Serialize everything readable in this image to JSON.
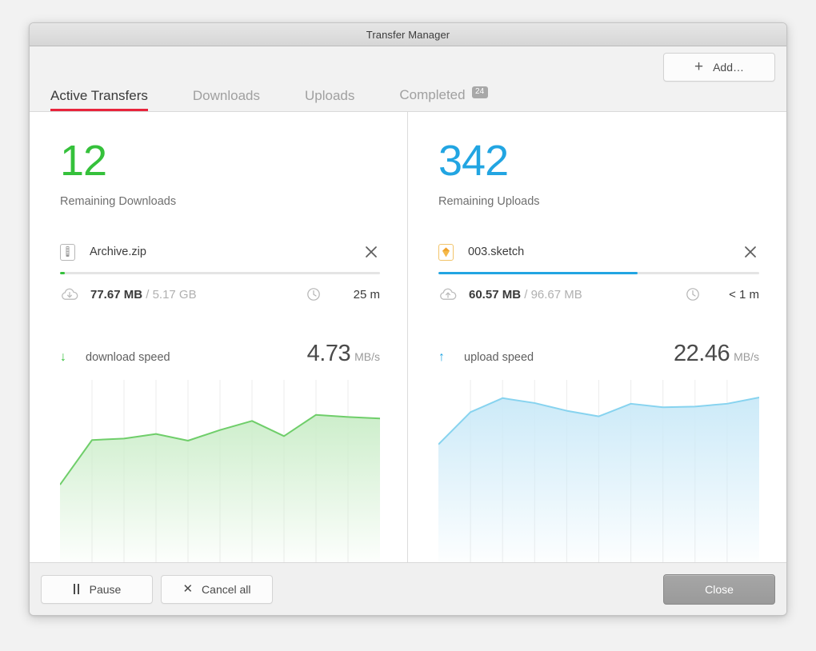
{
  "window": {
    "title": "Transfer Manager"
  },
  "toolbar": {
    "add_label": "Add…",
    "add_icon": "plus-icon"
  },
  "tabs": [
    {
      "label": "Active Transfers",
      "active": true,
      "badge": ""
    },
    {
      "label": "Downloads",
      "active": false,
      "badge": ""
    },
    {
      "label": "Uploads",
      "active": false,
      "badge": ""
    },
    {
      "label": "Completed",
      "active": false,
      "badge": "24"
    }
  ],
  "colors": {
    "accent_red": "#e8243c",
    "green": "#35c13b",
    "blue": "#22a5e2",
    "chart_green_line": "#6fce6a",
    "chart_blue_line": "#87d3ef",
    "badge_grey": "#a8a8a8",
    "close_button_grey": "#9e9e9e",
    "sketch_icon_orange": "#f5a623"
  },
  "downloads": {
    "count": "12",
    "count_label": "Remaining Downloads",
    "file": {
      "name": "Archive.zip",
      "icon": "zip-file-icon",
      "close_icon": "close-icon",
      "progress_percent": 1.5
    },
    "transferred": "77.67 MB",
    "separator": "/",
    "total": "5.17 GB",
    "transfer_icon": "cloud-download-icon",
    "eta_icon": "clock-icon",
    "eta": "25 m",
    "speed_icon": "arrow-down-icon",
    "speed_label": "download speed",
    "speed_value": "4.73",
    "speed_unit": "MB/s"
  },
  "uploads": {
    "count": "342",
    "count_label": "Remaining Uploads",
    "file": {
      "name": "003.sketch",
      "icon": "sketch-file-icon",
      "close_icon": "close-icon",
      "progress_percent": 62
    },
    "transferred": "60.57 MB",
    "separator": "/",
    "total": "96.67 MB",
    "transfer_icon": "cloud-upload-icon",
    "eta_icon": "clock-icon",
    "eta": "< 1 m",
    "speed_icon": "arrow-up-icon",
    "speed_label": "upload speed",
    "speed_value": "22.46",
    "speed_unit": "MB/s"
  },
  "footer": {
    "pause_label": "Pause",
    "pause_icon": "pause-icon",
    "cancel_label": "Cancel all",
    "cancel_icon": "close-icon",
    "close_label": "Close"
  },
  "chart_data": [
    {
      "type": "area",
      "title": "download speed",
      "ylabel": "MB/s",
      "xlabel": "",
      "grid": true,
      "gridlines": 10,
      "legend": "none",
      "ylim": [
        0,
        6
      ],
      "x": [
        0,
        1,
        2,
        3,
        4,
        5,
        6,
        7,
        8,
        9,
        10
      ],
      "values": [
        2.55,
        4.02,
        4.07,
        4.22,
        4.0,
        4.35,
        4.65,
        4.15,
        4.85,
        4.78,
        4.73
      ],
      "line_color": "#6fce6a",
      "fill_color": "#cdeecb"
    },
    {
      "type": "area",
      "title": "upload speed",
      "ylabel": "MB/s",
      "xlabel": "",
      "grid": true,
      "gridlines": 10,
      "legend": "none",
      "ylim": [
        0,
        26
      ],
      "x": [
        0,
        1,
        2,
        3,
        4,
        5,
        6,
        7,
        8,
        9,
        10
      ],
      "values": [
        16.8,
        21.4,
        23.4,
        22.7,
        21.6,
        20.8,
        22.6,
        22.1,
        22.2,
        22.6,
        23.5
      ],
      "line_color": "#87d3ef",
      "fill_color": "#cceaf8"
    }
  ]
}
